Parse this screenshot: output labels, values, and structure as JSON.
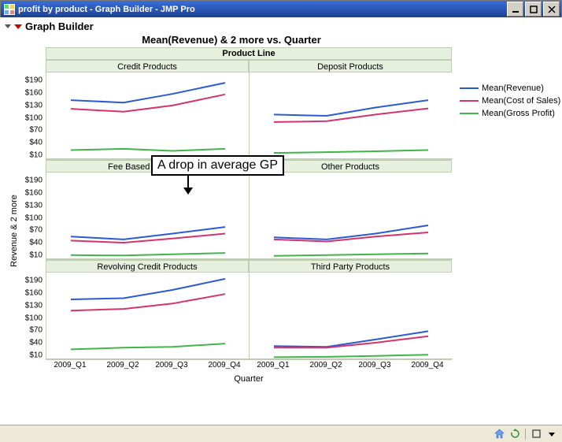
{
  "window": {
    "title": "profit by product - Graph Builder - JMP Pro"
  },
  "outline": {
    "title": "Graph Builder"
  },
  "chart": {
    "title": "Mean(Revenue) & 2 more vs. Quarter",
    "facet_var": "Product Line",
    "x_label": "Quarter",
    "y_label": "Revenue & 2 more"
  },
  "legend": {
    "items": [
      {
        "label": "Mean(Revenue)",
        "color": "#2a5bd7"
      },
      {
        "label": "Mean(Cost of Sales)",
        "color": "#d6336c"
      },
      {
        "label": "Mean(Gross Profit)",
        "color": "#3fb54a"
      }
    ]
  },
  "annotation": {
    "text": "A drop in average GP"
  },
  "chart_data": {
    "type": "line",
    "facet": "Product Line",
    "x": [
      "2009_Q1",
      "2009_Q2",
      "2009_Q3",
      "2009_Q4"
    ],
    "y_ticks": [
      10,
      40,
      70,
      100,
      130,
      160,
      190
    ],
    "ylim": [
      0,
      210
    ],
    "xlabel": "Quarter",
    "ylabel": "Revenue & 2 more",
    "title": "Mean(Revenue) & 2 more vs. Quarter",
    "legend_position": "right",
    "panels": [
      {
        "name": "Credit Products",
        "series": [
          {
            "name": "Mean(Revenue)",
            "color": "#2a5bd7",
            "values": [
              143,
              137,
              158,
              185
            ]
          },
          {
            "name": "Mean(Cost of Sales)",
            "color": "#d6336c",
            "values": [
              122,
              115,
              130,
              157
            ]
          },
          {
            "name": "Mean(Gross Profit)",
            "color": "#3fb54a",
            "values": [
              22,
              25,
              20,
              25
            ]
          }
        ]
      },
      {
        "name": "Deposit Products",
        "series": [
          {
            "name": "Mean(Revenue)",
            "color": "#2a5bd7",
            "values": [
              108,
              105,
              125,
              143
            ]
          },
          {
            "name": "Mean(Cost of Sales)",
            "color": "#d6336c",
            "values": [
              90,
              92,
              108,
              123
            ]
          },
          {
            "name": "Mean(Gross Profit)",
            "color": "#3fb54a",
            "values": [
              15,
              17,
              19,
              22
            ]
          }
        ]
      },
      {
        "name": "Fee Based Products",
        "series": [
          {
            "name": "Mean(Revenue)",
            "color": "#2a5bd7",
            "values": [
              55,
              48,
              62,
              78
            ]
          },
          {
            "name": "Mean(Cost of Sales)",
            "color": "#d6336c",
            "values": [
              45,
              40,
              50,
              62
            ]
          },
          {
            "name": "Mean(Gross Profit)",
            "color": "#3fb54a",
            "values": [
              10,
              9,
              12,
              15
            ]
          }
        ]
      },
      {
        "name": "Other Products",
        "series": [
          {
            "name": "Mean(Revenue)",
            "color": "#2a5bd7",
            "values": [
              53,
              48,
              62,
              82
            ]
          },
          {
            "name": "Mean(Cost of Sales)",
            "color": "#d6336c",
            "values": [
              48,
              43,
              55,
              65
            ]
          },
          {
            "name": "Mean(Gross Profit)",
            "color": "#3fb54a",
            "values": [
              8,
              10,
              12,
              14
            ]
          }
        ]
      },
      {
        "name": "Revolving Credit Products",
        "series": [
          {
            "name": "Mean(Revenue)",
            "color": "#2a5bd7",
            "values": [
              145,
              148,
              168,
              195
            ]
          },
          {
            "name": "Mean(Cost of Sales)",
            "color": "#d6336c",
            "values": [
              118,
              122,
              135,
              158
            ]
          },
          {
            "name": "Mean(Gross Profit)",
            "color": "#3fb54a",
            "values": [
              24,
              28,
              30,
              38
            ]
          }
        ]
      },
      {
        "name": "Third Party Products",
        "series": [
          {
            "name": "Mean(Revenue)",
            "color": "#2a5bd7",
            "values": [
              32,
              30,
              48,
              68
            ]
          },
          {
            "name": "Mean(Cost of Sales)",
            "color": "#d6336c",
            "values": [
              28,
              28,
              40,
              56
            ]
          },
          {
            "name": "Mean(Gross Profit)",
            "color": "#3fb54a",
            "values": [
              5,
              6,
              8,
              11
            ]
          }
        ]
      }
    ]
  }
}
